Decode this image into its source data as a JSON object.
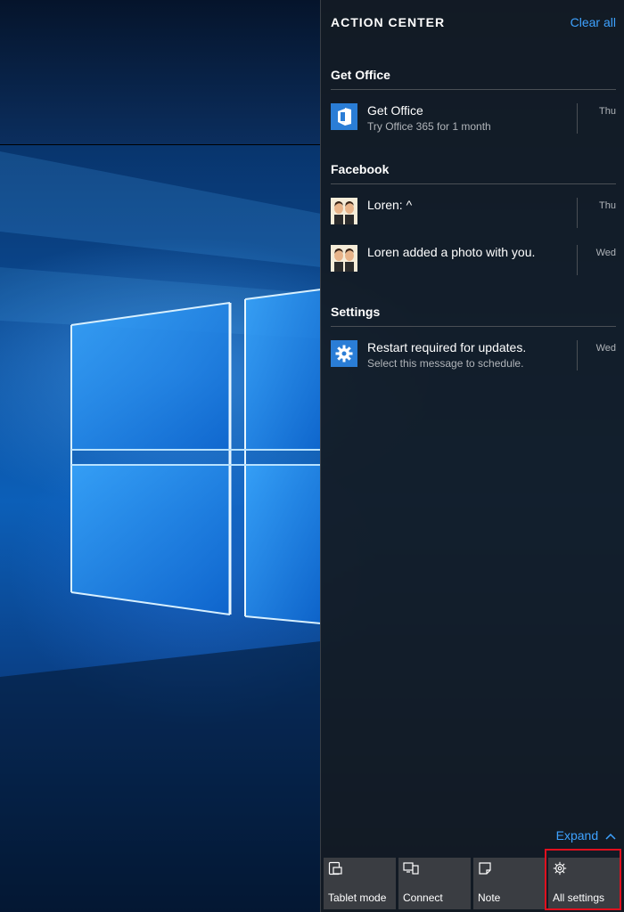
{
  "action_center": {
    "title": "ACTION CENTER",
    "clear_all": "Clear all",
    "groups": [
      {
        "header": "Get Office",
        "notifications": [
          {
            "title": "Get Office",
            "subtitle": "Try Office 365 for 1 month",
            "time": "Thu",
            "icon": "office-icon"
          }
        ]
      },
      {
        "header": "Facebook",
        "notifications": [
          {
            "title": "Loren: ^",
            "subtitle": "",
            "time": "Thu",
            "icon": "avatar"
          },
          {
            "title": "Loren added a photo with you.",
            "subtitle": "",
            "time": "Wed",
            "icon": "avatar"
          }
        ]
      },
      {
        "header": "Settings",
        "notifications": [
          {
            "title": "Restart required for updates.",
            "subtitle": "Select this message to schedule.",
            "time": "Wed",
            "icon": "gear-icon"
          }
        ]
      }
    ],
    "expand_label": "Expand",
    "quick_actions": [
      {
        "label": "Tablet mode",
        "icon": "tablet-mode-icon"
      },
      {
        "label": "Connect",
        "icon": "connect-icon"
      },
      {
        "label": "Note",
        "icon": "note-icon"
      },
      {
        "label": "All settings",
        "icon": "gear-icon",
        "highlighted": true
      }
    ]
  },
  "colors": {
    "accent": "#3ea2ff",
    "tile_blue": "#2a7dd6",
    "highlight": "#e0101e",
    "panel_bg": "#141a22"
  }
}
